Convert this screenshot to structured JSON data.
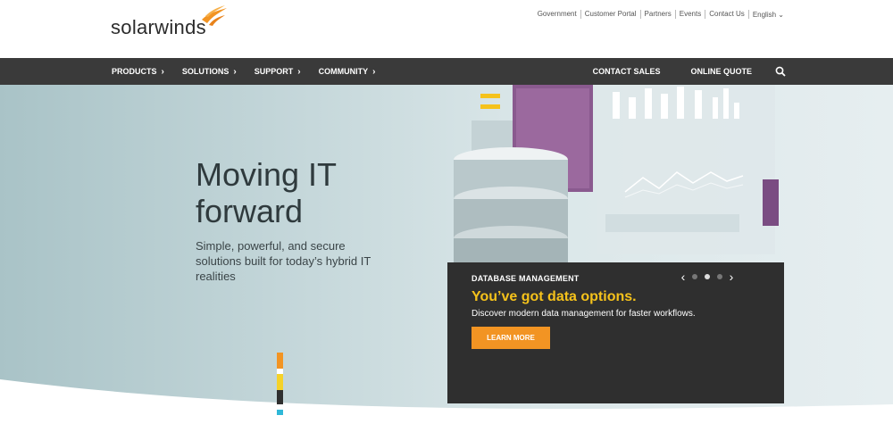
{
  "brand": {
    "logo_text": "solarwinds",
    "accent": "#f29423"
  },
  "utility_links": [
    "Government",
    "Customer Portal",
    "Partners",
    "Events",
    "Contact Us"
  ],
  "language": "English",
  "nav": {
    "left": [
      {
        "label": "PRODUCTS"
      },
      {
        "label": "SOLUTIONS"
      },
      {
        "label": "SUPPORT"
      },
      {
        "label": "COMMUNITY"
      }
    ],
    "right": [
      {
        "label": "CONTACT SALES"
      },
      {
        "label": "ONLINE QUOTE"
      }
    ],
    "search_icon": "search-icon"
  },
  "hero": {
    "headline_line1": "Moving IT",
    "headline_line2": "forward",
    "subtext": "Simple, powerful, and secure solutions built for today’s hybrid IT realities"
  },
  "callout": {
    "category": "DATABASE MANAGEMENT",
    "title": "You’ve got data options.",
    "description": "Discover modern data management for faster workflows.",
    "button": "LEARN MORE",
    "slides": 3,
    "active_slide": 2,
    "title_color": "#f5c21b"
  },
  "colors": {
    "nav_bg": "#3a3a3a",
    "callout_bg": "#2f2f2f"
  }
}
